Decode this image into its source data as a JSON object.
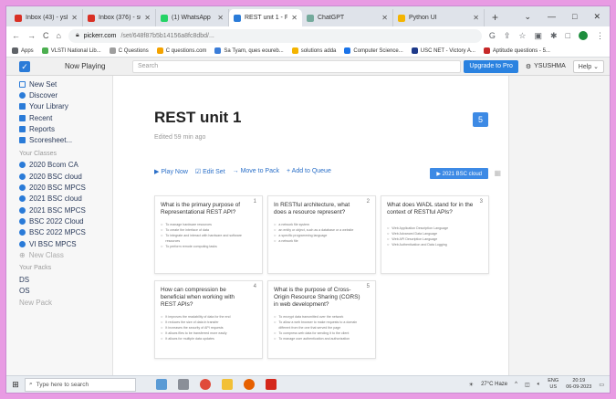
{
  "browser": {
    "tabs": [
      {
        "label": "Inbox (43) - ysl6ngd...",
        "color": "#d93025"
      },
      {
        "label": "Inbox (376) - sushma...",
        "color": "#d93025"
      },
      {
        "label": "(1) WhatsApp",
        "color": "#25d366"
      },
      {
        "label": "REST unit 1 - Flashcar",
        "color": "#2a7bd8",
        "active": true
      },
      {
        "label": "ChatGPT",
        "color": "#74aa9c"
      },
      {
        "label": "Python UI",
        "color": "#f4b400"
      }
    ],
    "new_tab": "+",
    "window_controls": [
      "⌄",
      "—",
      "□",
      "✕"
    ],
    "url_host": "pickerr.com",
    "url_path": "/set/648f87b5b14156a8fc8dbd/...",
    "bookmarks": [
      {
        "label": "Apps",
        "color": "#5f6368"
      },
      {
        "label": "VLSTI National Lib...",
        "color": "#4caf50"
      },
      {
        "label": "C Questions",
        "color": "#9e9e9e"
      },
      {
        "label": "C questions.com",
        "color": "#f4a300"
      },
      {
        "label": "Sa Tyam, ques eoureb...",
        "color": "#3b7dd8"
      },
      {
        "label": "solutions adda",
        "color": "#f4b400"
      },
      {
        "label": "Computer Science...",
        "color": "#1a73e8"
      },
      {
        "label": "USC NET - Victory A...",
        "color": "#1e3a8a"
      },
      {
        "label": "Aptitude questions - 5...",
        "color": "#c62828"
      }
    ]
  },
  "app": {
    "now_playing": "Now Playing",
    "search_placeholder": "Search",
    "upgrade": "Upgrade to Pro",
    "user": "YSUSHMA",
    "help": "Help ⌄"
  },
  "sidebar": {
    "items": [
      {
        "label": "New Set",
        "icon": "new-set-icon",
        "color": "#2a7bd8"
      },
      {
        "label": "Discover",
        "icon": "discover-icon",
        "color": "#2a7bd8"
      },
      {
        "label": "Your Library",
        "icon": "library-icon",
        "color": "#2a7bd8"
      },
      {
        "label": "Recent",
        "icon": "recent-icon",
        "color": "#2a7bd8"
      },
      {
        "label": "Reports",
        "icon": "reports-icon",
        "color": "#2a7bd8"
      },
      {
        "label": "Scoresheet...",
        "icon": "scoresheet-icon",
        "color": "#2a7bd8"
      }
    ],
    "classes_heading": "Your Classes",
    "classes": [
      "2020 Bcom CA",
      "2020 BSC cloud",
      "2020 BSC MPCS",
      "2021 BSC cloud",
      "2021 BSC MPCS",
      "BSC 2022 Cloud",
      "BSC 2022 MPCS",
      "VI BSC MPCS"
    ],
    "new_class": "New Class",
    "packs_heading": "Your Packs",
    "packs": [
      "DS",
      "OS"
    ],
    "new_pack": "New Pack"
  },
  "main": {
    "title": "REST unit 1",
    "edited": "Edited 59 min ago",
    "count": "5",
    "actions": {
      "play": "▶ Play Now",
      "edit": "☑ Edit Set",
      "move": "→ Move to Pack",
      "queue": "+ Add to Queue"
    },
    "deck_button": "▶ 2021 BSC cloud",
    "cards": [
      {
        "num": "1",
        "question": "What is the primary purpose of Representational REST API?",
        "options": [
          "To manage hardware resources",
          "To create the interface of data",
          "To integrate and interact with hardware and software resources",
          "To perform remote computing tasks"
        ]
      },
      {
        "num": "2",
        "question": "In RESTful architecture, what does a resource represent?",
        "options": [
          "a network file system",
          "an entity or object, such as a database or a website",
          "a specific programming language",
          "a network file"
        ]
      },
      {
        "num": "3",
        "question": "What does WADL stand for in the context of RESTful APIs?",
        "options": [
          "Web Application Description Language",
          "Web Advanced Data Language",
          "Web API Description Language",
          "Web Authentication and Data Logging"
        ]
      },
      {
        "num": "4",
        "question": "How can compression be beneficial when working with REST APIs?",
        "options": [
          "It improves the readability of data for the end",
          "It reduces the size of data in transfer",
          "It increases the security of API requests",
          "It allows files to be transferred more easily",
          "It allows for multiple data updates"
        ]
      },
      {
        "num": "5",
        "question": "What is the purpose of Cross-Origin Resource Sharing (CORS) in web development?",
        "options": [
          "To encrypt data transmitted over the network",
          "To allow a web browser to make requests to a domain different from the one that served the page",
          "To compress web data for sending it to the client",
          "To manage user authentication and authorization"
        ]
      }
    ]
  },
  "taskbar": {
    "search_placeholder": "Type here to search",
    "weather": "27°C Haze",
    "lang": "ENG",
    "region": "US",
    "time": "20:19",
    "date": "06-09-2023"
  }
}
